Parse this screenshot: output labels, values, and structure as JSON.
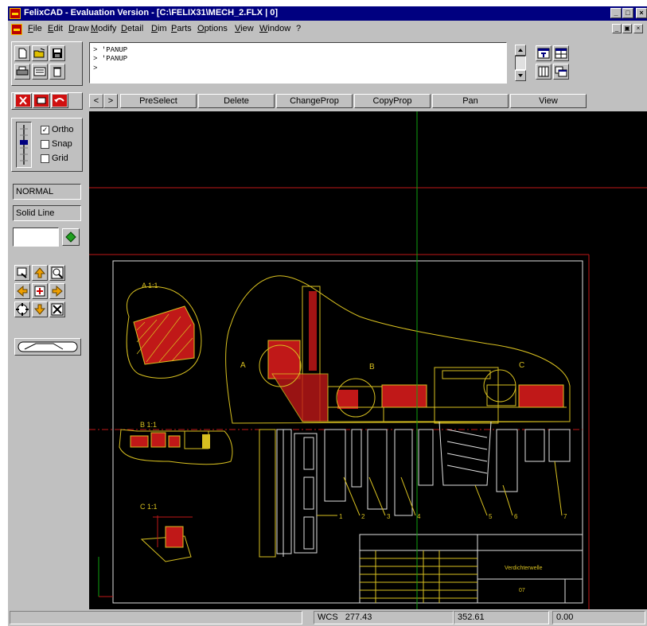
{
  "window": {
    "title": "FelixCAD - Evaluation Version - [C:\\FELIX31\\MECH_2.FLX | 0]",
    "caption_buttons": [
      "_",
      "□",
      "×"
    ]
  },
  "menu": {
    "items": [
      "File",
      "Edit",
      "Draw",
      "Modify",
      "Detail",
      "Dim",
      "Parts",
      "Options",
      "View",
      "Window",
      "?"
    ],
    "mdi_buttons": [
      "_",
      "▣",
      "×"
    ]
  },
  "command_area": {
    "lines": [
      "> 'PANUP",
      "> 'PANUP",
      ">"
    ]
  },
  "command_buttons": {
    "nav_prev": "<",
    "nav_next": ">",
    "items": [
      "PreSelect",
      "Delete",
      "ChangeProp",
      "CopyProp",
      "Pan",
      "View"
    ]
  },
  "toolbox": {
    "ortho": {
      "label": "Ortho",
      "checked": true
    },
    "snap": {
      "label": "Snap",
      "checked": false
    },
    "grid": {
      "label": "Grid",
      "checked": false
    },
    "mode_label": "NORMAL",
    "linetype_label": "Solid Line"
  },
  "drawing": {
    "labels": {
      "a_detail": "A 1:1",
      "b_detail": "B 1:1",
      "c_detail": "C 1:1",
      "marker_a": "A",
      "marker_b": "B",
      "marker_c": "C",
      "title_block_name": "Verdichterwelle",
      "title_block_no": "07"
    },
    "part_numbers": [
      "1",
      "2",
      "3",
      "4",
      "5",
      "6",
      "7"
    ]
  },
  "status": {
    "coord_system": "WCS",
    "x": "277.43",
    "y": "352.61",
    "z": "0.00"
  },
  "colors": {
    "title_bar": "#000080",
    "canvas": "#000000",
    "drawing_yellow": "#d8c020",
    "drawing_red": "#c01818",
    "crosshair_green": "#10a010",
    "frame_white": "#e0e0e0"
  }
}
